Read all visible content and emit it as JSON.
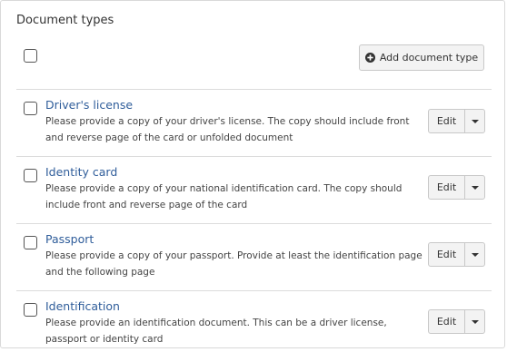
{
  "panel": {
    "title": "Document types",
    "add_button_label": "Add document type",
    "add_icon": "plus-circle-icon"
  },
  "document_types": [
    {
      "title": "Driver's license",
      "description": "Please provide a copy of your driver's license. The copy should include front and reverse page of the card or unfolded document",
      "edit_label": "Edit"
    },
    {
      "title": "Identity card",
      "description": "Please provide a copy of your national identification card. The copy should include front and reverse page of the card",
      "edit_label": "Edit"
    },
    {
      "title": "Passport",
      "description": "Please provide a copy of your passport. Provide at least the identification page and the following page",
      "edit_label": "Edit"
    },
    {
      "title": "Identification",
      "description": "Please provide an identification document. This can be a driver license, passport or identity card",
      "edit_label": "Edit"
    }
  ]
}
